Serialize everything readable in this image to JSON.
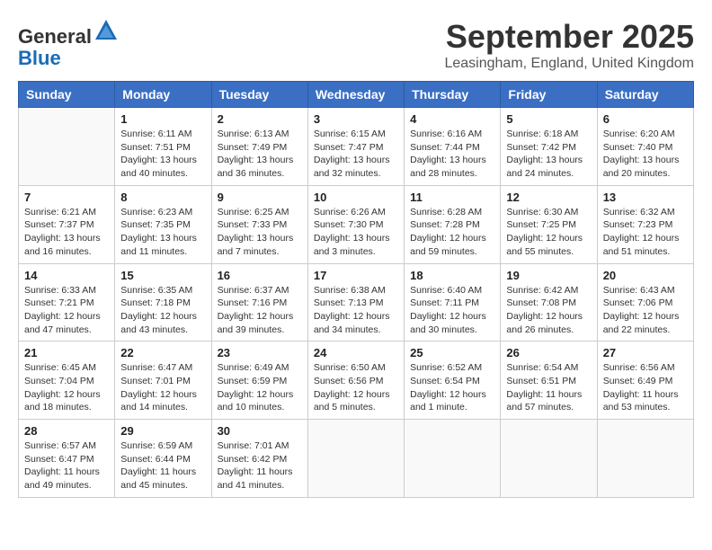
{
  "header": {
    "logo_line1": "General",
    "logo_line2": "Blue",
    "month_title": "September 2025",
    "location": "Leasingham, England, United Kingdom"
  },
  "weekdays": [
    "Sunday",
    "Monday",
    "Tuesday",
    "Wednesday",
    "Thursday",
    "Friday",
    "Saturday"
  ],
  "weeks": [
    [
      {
        "day": "",
        "info": ""
      },
      {
        "day": "1",
        "info": "Sunrise: 6:11 AM\nSunset: 7:51 PM\nDaylight: 13 hours\nand 40 minutes."
      },
      {
        "day": "2",
        "info": "Sunrise: 6:13 AM\nSunset: 7:49 PM\nDaylight: 13 hours\nand 36 minutes."
      },
      {
        "day": "3",
        "info": "Sunrise: 6:15 AM\nSunset: 7:47 PM\nDaylight: 13 hours\nand 32 minutes."
      },
      {
        "day": "4",
        "info": "Sunrise: 6:16 AM\nSunset: 7:44 PM\nDaylight: 13 hours\nand 28 minutes."
      },
      {
        "day": "5",
        "info": "Sunrise: 6:18 AM\nSunset: 7:42 PM\nDaylight: 13 hours\nand 24 minutes."
      },
      {
        "day": "6",
        "info": "Sunrise: 6:20 AM\nSunset: 7:40 PM\nDaylight: 13 hours\nand 20 minutes."
      }
    ],
    [
      {
        "day": "7",
        "info": "Sunrise: 6:21 AM\nSunset: 7:37 PM\nDaylight: 13 hours\nand 16 minutes."
      },
      {
        "day": "8",
        "info": "Sunrise: 6:23 AM\nSunset: 7:35 PM\nDaylight: 13 hours\nand 11 minutes."
      },
      {
        "day": "9",
        "info": "Sunrise: 6:25 AM\nSunset: 7:33 PM\nDaylight: 13 hours\nand 7 minutes."
      },
      {
        "day": "10",
        "info": "Sunrise: 6:26 AM\nSunset: 7:30 PM\nDaylight: 13 hours\nand 3 minutes."
      },
      {
        "day": "11",
        "info": "Sunrise: 6:28 AM\nSunset: 7:28 PM\nDaylight: 12 hours\nand 59 minutes."
      },
      {
        "day": "12",
        "info": "Sunrise: 6:30 AM\nSunset: 7:25 PM\nDaylight: 12 hours\nand 55 minutes."
      },
      {
        "day": "13",
        "info": "Sunrise: 6:32 AM\nSunset: 7:23 PM\nDaylight: 12 hours\nand 51 minutes."
      }
    ],
    [
      {
        "day": "14",
        "info": "Sunrise: 6:33 AM\nSunset: 7:21 PM\nDaylight: 12 hours\nand 47 minutes."
      },
      {
        "day": "15",
        "info": "Sunrise: 6:35 AM\nSunset: 7:18 PM\nDaylight: 12 hours\nand 43 minutes."
      },
      {
        "day": "16",
        "info": "Sunrise: 6:37 AM\nSunset: 7:16 PM\nDaylight: 12 hours\nand 39 minutes."
      },
      {
        "day": "17",
        "info": "Sunrise: 6:38 AM\nSunset: 7:13 PM\nDaylight: 12 hours\nand 34 minutes."
      },
      {
        "day": "18",
        "info": "Sunrise: 6:40 AM\nSunset: 7:11 PM\nDaylight: 12 hours\nand 30 minutes."
      },
      {
        "day": "19",
        "info": "Sunrise: 6:42 AM\nSunset: 7:08 PM\nDaylight: 12 hours\nand 26 minutes."
      },
      {
        "day": "20",
        "info": "Sunrise: 6:43 AM\nSunset: 7:06 PM\nDaylight: 12 hours\nand 22 minutes."
      }
    ],
    [
      {
        "day": "21",
        "info": "Sunrise: 6:45 AM\nSunset: 7:04 PM\nDaylight: 12 hours\nand 18 minutes."
      },
      {
        "day": "22",
        "info": "Sunrise: 6:47 AM\nSunset: 7:01 PM\nDaylight: 12 hours\nand 14 minutes."
      },
      {
        "day": "23",
        "info": "Sunrise: 6:49 AM\nSunset: 6:59 PM\nDaylight: 12 hours\nand 10 minutes."
      },
      {
        "day": "24",
        "info": "Sunrise: 6:50 AM\nSunset: 6:56 PM\nDaylight: 12 hours\nand 5 minutes."
      },
      {
        "day": "25",
        "info": "Sunrise: 6:52 AM\nSunset: 6:54 PM\nDaylight: 12 hours\nand 1 minute."
      },
      {
        "day": "26",
        "info": "Sunrise: 6:54 AM\nSunset: 6:51 PM\nDaylight: 11 hours\nand 57 minutes."
      },
      {
        "day": "27",
        "info": "Sunrise: 6:56 AM\nSunset: 6:49 PM\nDaylight: 11 hours\nand 53 minutes."
      }
    ],
    [
      {
        "day": "28",
        "info": "Sunrise: 6:57 AM\nSunset: 6:47 PM\nDaylight: 11 hours\nand 49 minutes."
      },
      {
        "day": "29",
        "info": "Sunrise: 6:59 AM\nSunset: 6:44 PM\nDaylight: 11 hours\nand 45 minutes."
      },
      {
        "day": "30",
        "info": "Sunrise: 7:01 AM\nSunset: 6:42 PM\nDaylight: 11 hours\nand 41 minutes."
      },
      {
        "day": "",
        "info": ""
      },
      {
        "day": "",
        "info": ""
      },
      {
        "day": "",
        "info": ""
      },
      {
        "day": "",
        "info": ""
      }
    ]
  ]
}
